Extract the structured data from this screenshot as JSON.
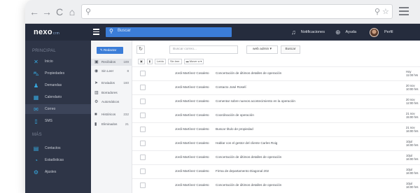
{
  "browser": {
    "back_icon": "arrow-left-icon",
    "forward_icon": "arrow-right-icon",
    "reload_icon": "reload-icon",
    "home_icon": "home-icon"
  },
  "header": {
    "logo": "nexo",
    "logo_suffix": "crm",
    "search_placeholder": "Buscar",
    "notifications": "Notificaciones",
    "help": "Ayuda",
    "profile": "Perfil"
  },
  "sidebar": {
    "section_main": "PRINCIPAL",
    "section_more": "MÁS",
    "items": [
      {
        "label": "Inicio",
        "icon": "close-x-icon"
      },
      {
        "label": "Propiedades",
        "icon": "car-icon"
      },
      {
        "label": "Demandas",
        "icon": "people-icon"
      },
      {
        "label": "Calendario",
        "icon": "calendar-icon"
      },
      {
        "label": "Correo",
        "icon": "mail-icon"
      },
      {
        "label": "SMS",
        "icon": "phone-icon"
      }
    ],
    "more_items": [
      {
        "label": "Contactos",
        "icon": "contacts-icon"
      },
      {
        "label": "Estadísticas",
        "icon": "stats-icon"
      },
      {
        "label": "Ajustes",
        "icon": "gear-icon"
      }
    ]
  },
  "folders": {
    "compose_label": "Redactar",
    "items": [
      {
        "label": "Recibidos",
        "count": "189"
      },
      {
        "label": "Sin Leer",
        "count": "8"
      },
      {
        "label": "Enviados",
        "count": "160"
      },
      {
        "label": "Borradores",
        "count": ""
      },
      {
        "label": "Automáticos",
        "count": ""
      },
      {
        "label": "Históricos",
        "count": "232"
      },
      {
        "label": "Eliminados",
        "count": "21"
      }
    ]
  },
  "toolbar": {
    "search_placeholder": "Buscar correo...",
    "account": "web admin ▾",
    "search_button": "Buscar",
    "leido": "Leído",
    "sin_leer": "Sin leer",
    "mover": "Mover a ▾"
  },
  "emails": [
    {
      "from": "Jordi Martínez Cosaleto",
      "subject": "Concertación de últimos detalles de operación",
      "date1": "Hoy",
      "date2": "11:00 hrs"
    },
    {
      "from": "Jordi Martínez Cosaleto",
      "subject": "Contacto José Roselí",
      "date1": "20 nov",
      "date2": "10:00 hrs"
    },
    {
      "from": "Jordi Martínez Cosaleto",
      "subject": "Comentar sobre nuevos acontecimiento en la operación",
      "date1": "20 nov",
      "date2": "12:00 hrs"
    },
    {
      "from": "Jordi Martínez Cosaleto",
      "subject": "Coordinación de operación",
      "date1": "21 nov",
      "date2": "15:00 hrs"
    },
    {
      "from": "Jordi Martínez Cosaleto",
      "subject": "Buscar título de propiedad",
      "date1": "21 nov",
      "date2": "16:00 hrs"
    },
    {
      "from": "Jordi Martínez Cosaleto",
      "subject": "Hablar con el gestor del cliente Carles Roig",
      "date1": "10jul",
      "date2": "16:00 hrs"
    },
    {
      "from": "Jordi Martínez Cosaleto",
      "subject": "Concertación de últimos detalles de operación",
      "date1": "10jul",
      "date2": "16:00 hrs"
    },
    {
      "from": "Jordi Martínez Cosaleto",
      "subject": "Firma de departamento Diagonal 202",
      "date1": "10jul",
      "date2": "16:00 hrs"
    },
    {
      "from": "Jordi Martínez Cosaleto",
      "subject": "Concertación de últimos detalles de operación",
      "date1": "10jul",
      "date2": "16:00 hrs"
    }
  ]
}
